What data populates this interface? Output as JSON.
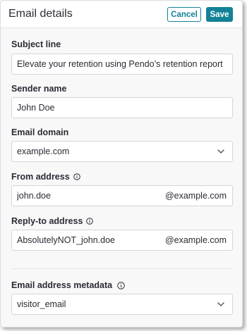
{
  "header": {
    "title": "Email details",
    "cancel_label": "Cancel",
    "save_label": "Save"
  },
  "colors": {
    "accent": "#128297",
    "panel_bg": "#f8f8f9",
    "border": "#d3d5da"
  },
  "form": {
    "subject": {
      "label": "Subject line",
      "value": "Elevate your retention using Pendo’s retention report"
    },
    "sender": {
      "label": "Sender name",
      "value": "John Doe"
    },
    "domain": {
      "label": "Email domain",
      "value": "example.com",
      "icon": "chevron-down-icon"
    },
    "from": {
      "label": "From address",
      "value": "john.doe",
      "suffix": "@example.com",
      "icon": "info-icon"
    },
    "reply_to": {
      "label": "Reply-to address",
      "value": "AbsolutelyNOT_john.doe",
      "suffix": "@example.com",
      "icon": "info-icon"
    },
    "metadata": {
      "label": "Email address metadata",
      "value": "visitor_email",
      "icon": "info-icon"
    }
  }
}
